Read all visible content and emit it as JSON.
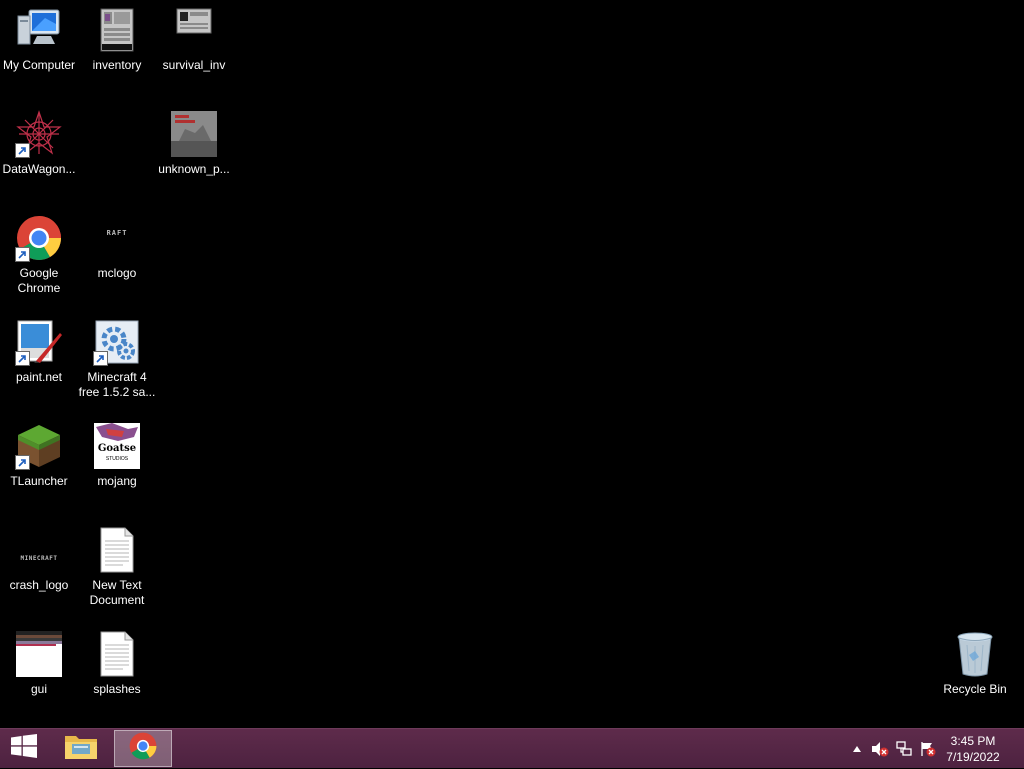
{
  "desktop": {
    "icons": [
      {
        "label": "My Computer",
        "icon": "computer-icon"
      },
      {
        "label": "inventory",
        "icon": "image-file-icon"
      },
      {
        "label": "survival_inv",
        "icon": "image-file-icon"
      },
      {
        "label": "DataWagon...",
        "icon": "datawagon-app-icon"
      },
      {
        "label": "unknown_p...",
        "icon": "image-file-icon"
      },
      {
        "label": "Google\nChrome",
        "icon": "chrome-icon"
      },
      {
        "label": "mclogo",
        "icon": "image-file-icon"
      },
      {
        "label": "paint.net",
        "icon": "paintnet-icon"
      },
      {
        "label": "Minecraft 4\nfree 1.5.2 sa...",
        "icon": "installer-icon"
      },
      {
        "label": "TLauncher",
        "icon": "grass-block-icon"
      },
      {
        "label": "mojang",
        "icon": "image-file-icon"
      },
      {
        "label": "crash_logo",
        "icon": "image-file-icon"
      },
      {
        "label": "New Text\nDocument",
        "icon": "text-document-icon"
      },
      {
        "label": "gui",
        "icon": "image-file-icon"
      },
      {
        "label": "splashes",
        "icon": "text-document-icon"
      },
      {
        "label": "Recycle Bin",
        "icon": "recycle-bin-icon"
      }
    ],
    "thumb_texts": {
      "mclogo": "RAFT",
      "crash_logo": "MINECRAFT",
      "mojang": "Goatse",
      "mojang_sub": "STUDIOS"
    }
  },
  "taskbar": {
    "start": "windows-logo-icon",
    "pinned": [
      "file-explorer-icon",
      "chrome-icon"
    ],
    "tray": [
      "show-hidden-icons-icon",
      "volume-muted-icon",
      "network-icon",
      "action-center-icon"
    ],
    "clock": {
      "time": "3:45 PM",
      "date": "7/19/2022"
    }
  },
  "colors": {
    "taskbar": "#56264a",
    "desktop": "#000000"
  }
}
